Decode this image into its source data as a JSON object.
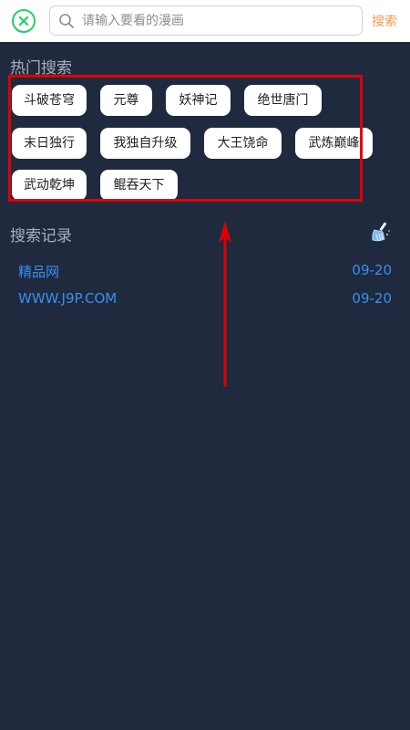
{
  "search": {
    "placeholder": "请输入要看的漫画",
    "button_label": "搜索"
  },
  "hot": {
    "title": "热门搜索",
    "tags": [
      "斗破苍穹",
      "元尊",
      "妖神记",
      "绝世唐门",
      "末日独行",
      "我独自升级",
      "大王饶命",
      "武炼巅峰",
      "武动乾坤",
      "鲲吞天下"
    ]
  },
  "history": {
    "title": "搜索记录",
    "clear_icon": "broom-icon",
    "items": [
      {
        "term": "精品网",
        "date": "09-20"
      },
      {
        "term": "WWW.J9P.COM",
        "date": "09-20"
      }
    ]
  },
  "colors": {
    "background": "#1f2a3f",
    "accent_green": "#1fcf6a",
    "accent_orange": "#f39a4b",
    "link_blue": "#3a8ff0",
    "annotation_red": "#e00000"
  }
}
